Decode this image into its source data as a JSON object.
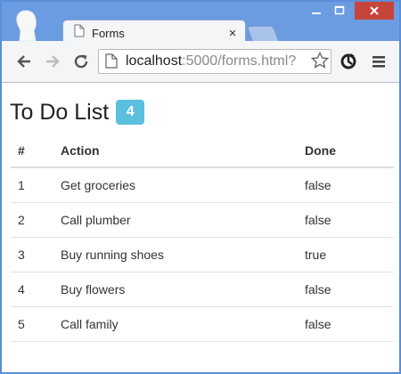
{
  "browser": {
    "tab_title": "Forms",
    "tab_close_glyph": "×",
    "url_host": "localhost",
    "url_path": ":5000/forms.html?",
    "accent": "#6b9be0",
    "close_button_color": "#c7443a"
  },
  "page": {
    "title": "To Do List",
    "badge_count": "4",
    "badge_color": "#5bc0de",
    "table": {
      "headers": [
        "#",
        "Action",
        "Done"
      ],
      "rows": [
        {
          "num": "1",
          "action": "Get groceries",
          "done": "false"
        },
        {
          "num": "2",
          "action": "Call plumber",
          "done": "false"
        },
        {
          "num": "3",
          "action": "Buy running shoes",
          "done": "true"
        },
        {
          "num": "4",
          "action": "Buy flowers",
          "done": "false"
        },
        {
          "num": "5",
          "action": "Call family",
          "done": "false"
        }
      ]
    }
  },
  "icons": {
    "profile": "person-icon",
    "tab": "page-icon",
    "back": "back-arrow-icon",
    "forward": "forward-arrow-icon",
    "reload": "reload-icon",
    "bookmark": "star-icon",
    "extension": "extension-icon",
    "menu": "hamburger-menu-icon"
  }
}
